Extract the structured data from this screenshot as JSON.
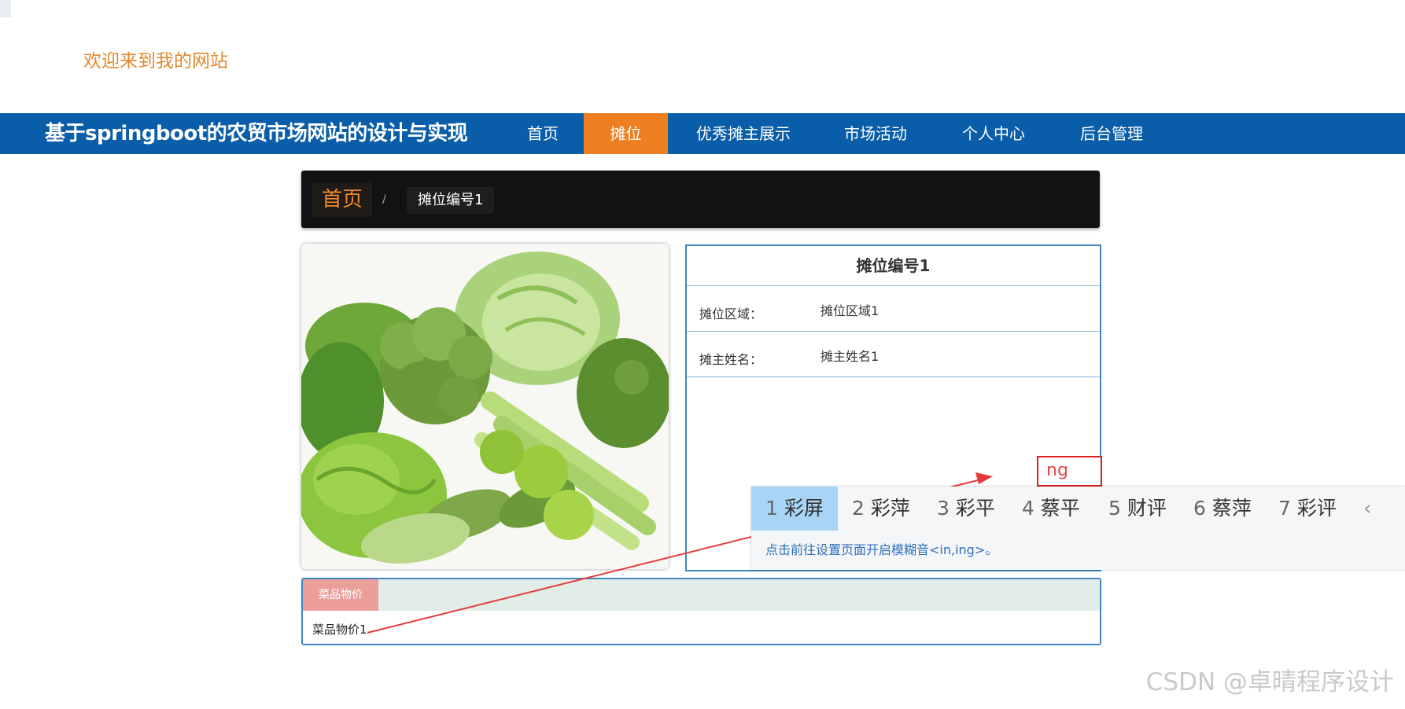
{
  "header": {
    "welcome_text": "欢迎来到我的网站"
  },
  "navbar": {
    "site_title": "基于springboot的农贸市场网站的设计与实现",
    "items": [
      {
        "label": "首页"
      },
      {
        "label": "摊位",
        "active": true
      },
      {
        "label": "优秀摊主展示"
      },
      {
        "label": "市场活动"
      },
      {
        "label": "个人中心"
      },
      {
        "label": "后台管理"
      }
    ]
  },
  "breadcrumb": {
    "home": "首页",
    "separator": "/",
    "current": "摊位编号1"
  },
  "image": {
    "subject": "vegetables-photo"
  },
  "info": {
    "title": "摊位编号1",
    "rows": [
      {
        "label": "摊位区域：",
        "value": "摊位区域1"
      },
      {
        "label": "摊主姓名：",
        "value": "摊主姓名1"
      }
    ]
  },
  "ime": {
    "typed": "ng",
    "candidates": [
      {
        "num": "1",
        "text": "彩屏"
      },
      {
        "num": "2",
        "text": "彩萍"
      },
      {
        "num": "3",
        "text": "彩平"
      },
      {
        "num": "4",
        "text": "蔡平"
      },
      {
        "num": "5",
        "text": "财评"
      },
      {
        "num": "6",
        "text": "蔡萍"
      },
      {
        "num": "7",
        "text": "彩评"
      }
    ],
    "prev_icon": "chevron-left-icon",
    "hint": "点击前往设置页面开启模糊音<in,ing>。"
  },
  "price": {
    "tab_label": "菜品物价",
    "content": "菜品物价1"
  },
  "watermark": "CSDN @卓晴程序设计",
  "colors": {
    "nav_bg": "#0a5ea9",
    "nav_active": "#ee7f20",
    "welcome": "#e0892c",
    "panel_border": "#3f86c2",
    "annotation_red": "#e11c1c"
  }
}
